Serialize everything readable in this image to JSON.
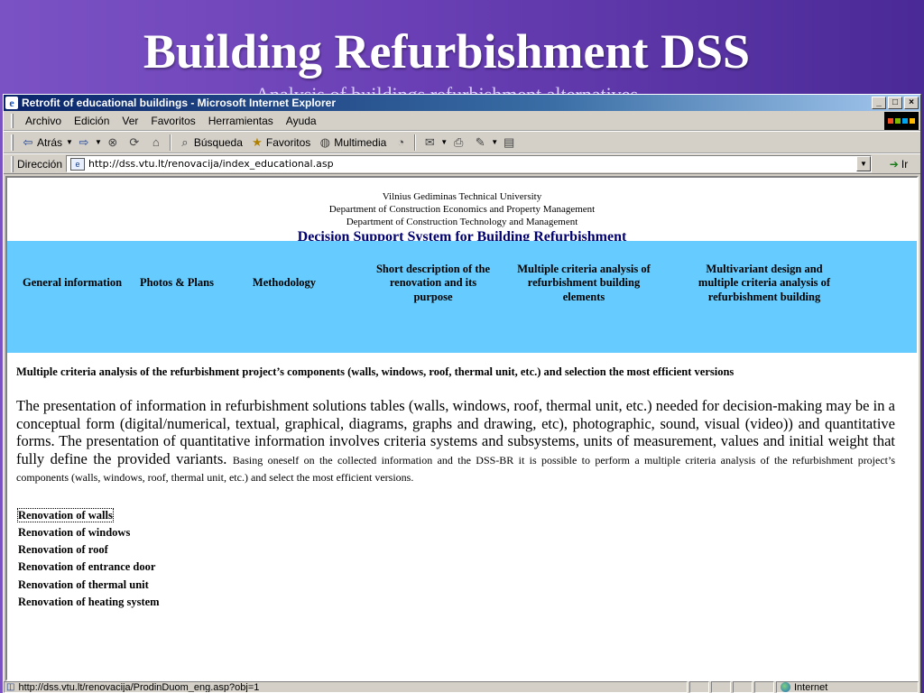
{
  "slide": {
    "title": "Building Refurbishment DSS",
    "subtitle": "Analysis of buildings refurbishment alternatives"
  },
  "window": {
    "title": "Retrofit of educational buildings - Microsoft Internet Explorer",
    "buttons": [
      "_",
      "□",
      "×"
    ]
  },
  "menu": {
    "items": [
      "Archivo",
      "Edición",
      "Ver",
      "Favoritos",
      "Herramientas",
      "Ayuda"
    ]
  },
  "toolbar": {
    "back_label": "Atrás",
    "search_label": "Búsqueda",
    "favorites_label": "Favoritos",
    "media_label": "Multimedia"
  },
  "address": {
    "label": "Dirección",
    "url": "http://dss.vtu.lt/renovacija/index_educational.asp",
    "go_label": "Ir"
  },
  "page": {
    "university": "Vilnius Gediminas Technical University",
    "dept1": "Department of Construction Economics and Property Management",
    "dept2": "Department of Construction Technology and Management",
    "heading": "Decision Support System for Building Refurbishment",
    "nav": [
      "General information",
      "Photos & Plans",
      "Methodology",
      "Short description of the renovation and its purpose",
      "Multiple criteria analysis of refurbishment building elements",
      "Multivariant design and multiple criteria analysis of refurbishment building"
    ],
    "main_heading": "Multiple criteria analysis of the refurbishment project’s components (walls, windows, roof, thermal unit, etc.) and selection the most efficient versions",
    "paragraph_large": "The presentation of information in refurbishment solutions tables (walls, windows, roof, thermal unit, etc.) needed for decision-making may be in a conceptual form (digital/numerical, textual, graphical, diagrams, graphs and drawing, etc), photographic, sound, visual (video)) and quantitative forms. The presentation of quantitative information involves criteria systems and subsystems, units of measurement, values and initial weight that fully define the provided variants.",
    "paragraph_small": "Basing oneself on the collected information and the DSS-BR it is possible to perform a multiple criteria analysis of the refurbishment project’s components (walls, windows, roof, thermal unit, etc.) and select the most efficient versions.",
    "links": [
      "Renovation of walls",
      "Renovation of windows",
      "Renovation of roof",
      "Renovation of entrance door",
      "Renovation of thermal unit",
      "Renovation of heating system"
    ]
  },
  "status": {
    "text": "http://dss.vtu.lt/renovacija/ProdinDuom_eng.asp?obj=1",
    "zone": "Internet"
  }
}
